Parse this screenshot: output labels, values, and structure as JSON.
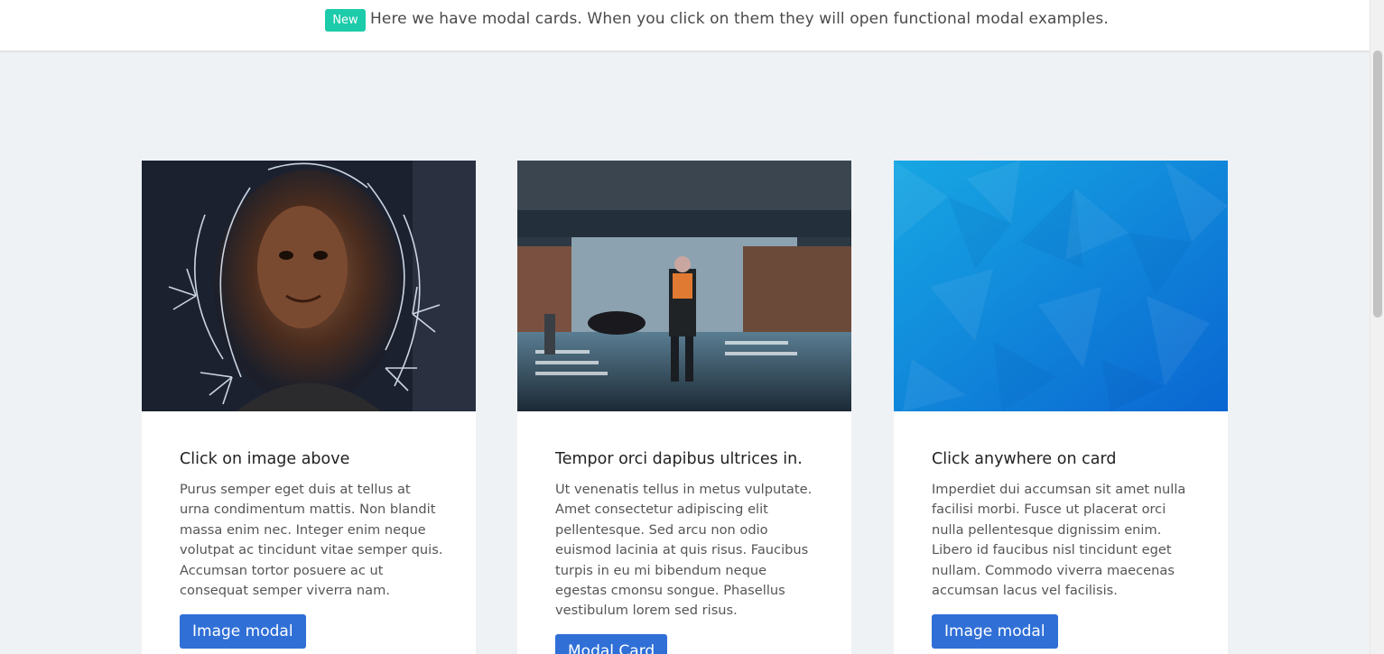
{
  "announcement": {
    "badge": "New",
    "text": "Here we have modal cards. When you click on them they will open functional modal examples."
  },
  "cards": [
    {
      "title": "Click on image above",
      "text": "Purus semper eget duis at tellus at urna condimentum mattis. Non blandit massa enim nec. Integer enim neque volutpat ac tincidunt vitae semper quis. Accumsan tortor posuere ac ut consequat semper viverra nam.",
      "button": "Image modal"
    },
    {
      "title": "Tempor orci dapibus ultrices in.",
      "text": "Ut venenatis tellus in metus vulputate. Amet consectetur adipiscing elit pellentesque. Sed arcu non odio euismod lacinia at quis risus. Faucibus turpis in eu mi bibendum neque egestas cmonsu songue. Phasellus vestibulum lorem sed risus.",
      "button": "Modal Card"
    },
    {
      "title": "Click anywhere on card",
      "text": "Imperdiet dui accumsan sit amet nulla facilisi morbi. Fusce ut placerat orci nulla pellentesque dignissim enim. Libero id faucibus nisl tincidunt eget nullam. Commodo viverra maecenas accumsan lacus vel facilisis.",
      "button": "Image modal"
    }
  ],
  "colors": {
    "page_background": "#eff2f4",
    "badge": "#1ccbaa",
    "button": "#2f6fd6"
  }
}
